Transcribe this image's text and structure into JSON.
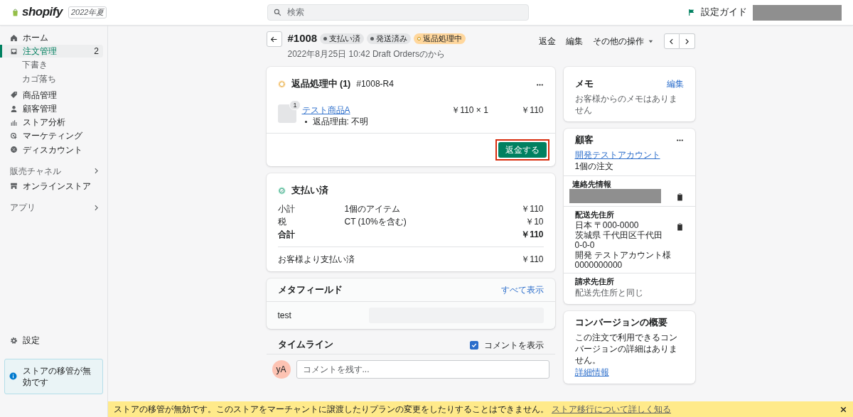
{
  "topbar": {
    "logo": "shopify",
    "edition": "2022年夏",
    "search_placeholder": "検索",
    "setup_guide": "設定ガイド"
  },
  "sidebar": {
    "items": [
      {
        "label": "ホーム",
        "selected": false
      },
      {
        "label": "注文管理",
        "selected": true,
        "count": "2",
        "children": [
          {
            "label": "下書き",
            "selected": false
          },
          {
            "label": "カゴ落ち",
            "selected": false
          }
        ]
      },
      {
        "label": "商品管理",
        "selected": false
      },
      {
        "label": "顧客管理",
        "selected": false
      },
      {
        "label": "ストア分析",
        "selected": false
      },
      {
        "label": "マーケティング",
        "selected": false
      },
      {
        "label": "ディスカウント",
        "selected": false
      }
    ],
    "sections": [
      {
        "title": "販売チャネル",
        "items": [
          {
            "label": "オンラインストア",
            "selected": false
          }
        ]
      },
      {
        "title": "アプリ"
      }
    ],
    "settings": "設定",
    "notice": "ストアの移管が無効です"
  },
  "order": {
    "number": "#1008",
    "badges": [
      {
        "label": "支払い済",
        "kind": "neutral"
      },
      {
        "label": "発送済み",
        "kind": "neutral"
      },
      {
        "label": "返品処理中",
        "kind": "warning"
      }
    ],
    "subtitle": "2022年8月25日 10:42 Draft Ordersのから",
    "actions": [
      "返金",
      "編集",
      "その他の操作"
    ]
  },
  "return_card": {
    "title": "返品処理中 (1)",
    "reference": "#1008-R4",
    "item": {
      "quantity": "1",
      "name": "テスト商品A",
      "reason": "返品理由: 不明",
      "price": "￥110 × 1",
      "total": "￥110"
    },
    "button": "返金する",
    "highlighted": true
  },
  "payment_card": {
    "title": "支払い済",
    "rows": [
      {
        "label": "小計",
        "detail": "1個のアイテム",
        "amount": "￥110",
        "kind": "normal"
      },
      {
        "label": "税",
        "detail": "CT (10%を含む)",
        "amount": "￥10",
        "kind": "normal"
      },
      {
        "label": "合計",
        "amount": "￥110",
        "kind": "total"
      }
    ],
    "paid_label": "お客様より支払い済",
    "paid_amount": "￥110"
  },
  "metafields": {
    "title": "メタフィールド",
    "link": "すべて表示",
    "rows": [
      {
        "label": "test"
      }
    ]
  },
  "timeline": {
    "title": "タイムライン",
    "show_comments": {
      "label": "コメントを表示",
      "checked": true
    },
    "avatar": "yA",
    "comment_placeholder": "コメントを残す..."
  },
  "memo": {
    "title": "メモ",
    "link": "編集",
    "text": "お客様からのメモはありません"
  },
  "customer": {
    "title": "顧客",
    "name": "開発テストアカウント",
    "orders": "1個の注文",
    "contact_title": "連絡先情報",
    "shipping_title": "配送先住所",
    "shipping_lines": [
      "日本 〒000-0000",
      "茨城県 千代田区千代田",
      "0-0-0",
      "開発 テストアカウント様",
      "0000000000"
    ],
    "billing_title": "請求先住所",
    "billing_text": "配送先住所と同じ"
  },
  "conversion": {
    "title": "コンバージョンの概要",
    "text": "この注文で利用できるコンバージョンの詳細はありません。",
    "link": "詳細情報"
  },
  "banner": {
    "text": "ストアの移管が無効です。このストアをマーチャントに譲渡したりプランの変更をしたりすることはできません。",
    "link": "ストア移行について詳しく知る"
  }
}
